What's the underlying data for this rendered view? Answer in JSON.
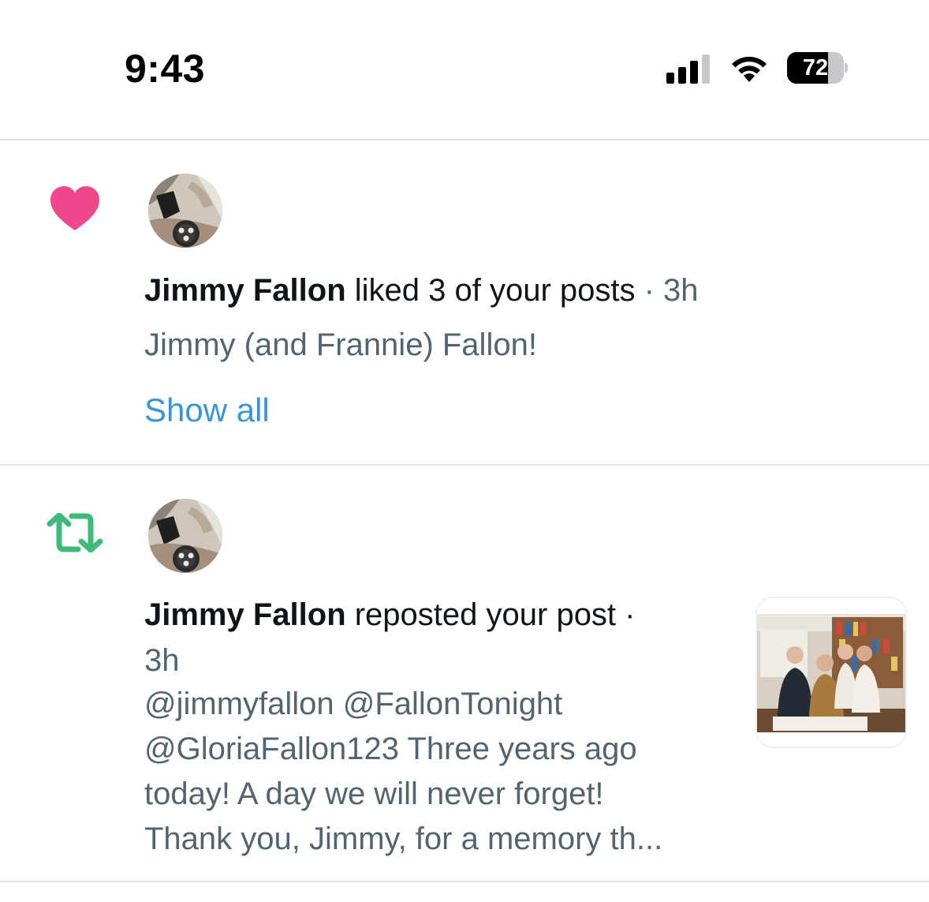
{
  "status_bar": {
    "time": "9:43",
    "battery_percent": "72",
    "battery_level": 0.72,
    "signal_bars_active": 3,
    "signal_bars_total": 4
  },
  "notifications": [
    {
      "type_icon": "heart-icon",
      "icon_color": "#f0468c",
      "user_name": "Jimmy Fallon",
      "action": " liked 3 of your posts",
      "time": " · 3h",
      "snippet": "Jimmy (and Frannie) Fallon!",
      "show_all_label": "Show all"
    },
    {
      "type_icon": "repost-icon",
      "icon_color": "#3ebb7a",
      "user_name": "Jimmy Fallon",
      "action": " reposted your post ·",
      "time": "3h",
      "snippet_lines": [
        "@jimmyfallon @FallonTonight",
        "@GloriaFallon123 Three years ago",
        "today! A day we will never forget!",
        "Thank you, Jimmy, for a memory th..."
      ]
    }
  ],
  "colors": {
    "link": "#3b94d9",
    "secondary_text": "#536471",
    "divider": "#e1e4e6"
  }
}
